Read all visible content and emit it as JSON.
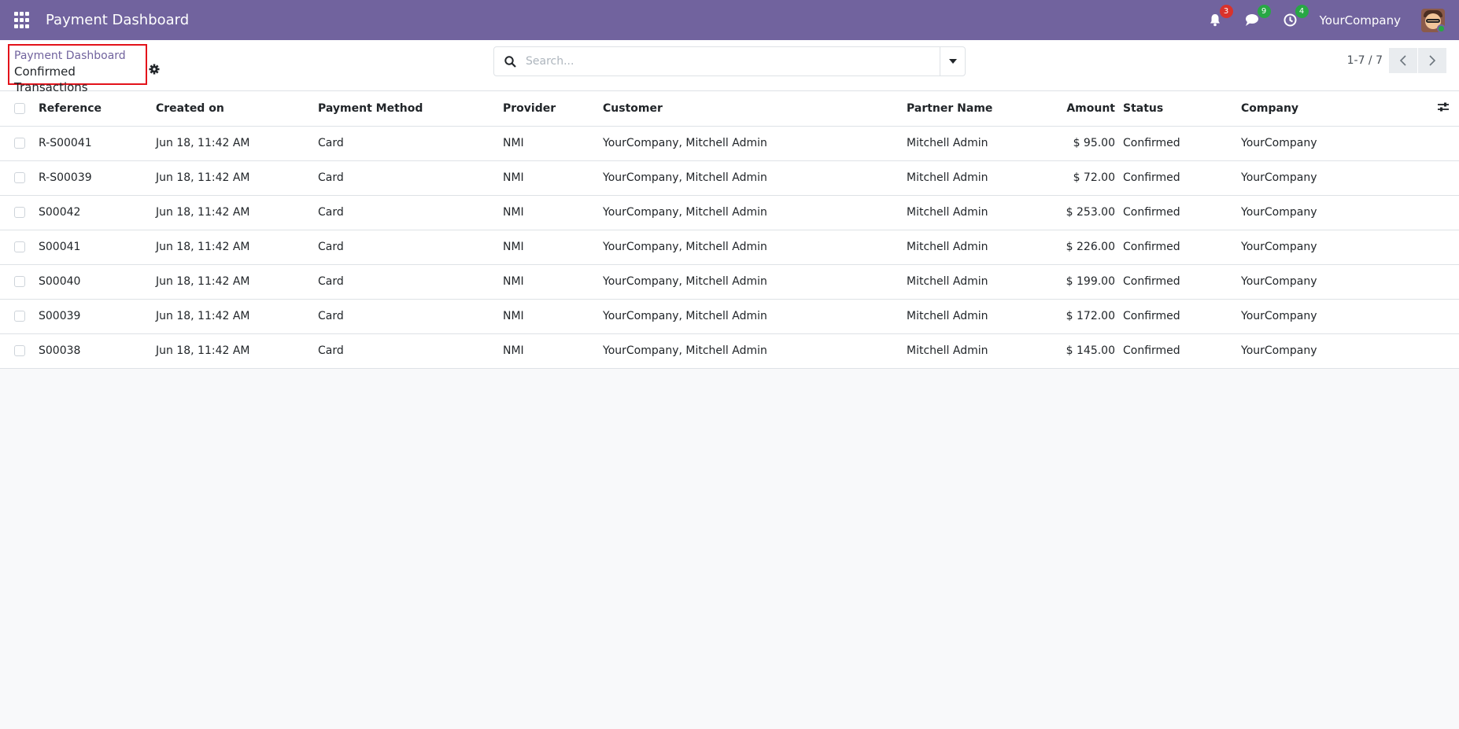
{
  "navbar": {
    "brand": "Payment Dashboard",
    "company": "YourCompany",
    "badges": {
      "activity": "3",
      "messages": "9",
      "clock": "4"
    },
    "colors": {
      "bg": "#71639e",
      "badge_red": "#e3342f",
      "badge_green": "#28a745"
    }
  },
  "breadcrumb": {
    "parent": "Payment Dashboard",
    "current": "Confirmed Transactions"
  },
  "search": {
    "placeholder": "Search..."
  },
  "pager": {
    "value": "1-7 / 7"
  },
  "table": {
    "columns": [
      "Reference",
      "Created on",
      "Payment Method",
      "Provider",
      "Customer",
      "Partner Name",
      "Amount",
      "Status",
      "Company"
    ],
    "rows": [
      {
        "ref": "R-S00041",
        "created": "Jun 18, 11:42 AM",
        "method": "Card",
        "provider": "NMI",
        "customer": "YourCompany, Mitchell Admin",
        "partner": "Mitchell Admin",
        "amount": "$ 95.00",
        "status": "Confirmed",
        "company": "YourCompany"
      },
      {
        "ref": "R-S00039",
        "created": "Jun 18, 11:42 AM",
        "method": "Card",
        "provider": "NMI",
        "customer": "YourCompany, Mitchell Admin",
        "partner": "Mitchell Admin",
        "amount": "$ 72.00",
        "status": "Confirmed",
        "company": "YourCompany"
      },
      {
        "ref": "S00042",
        "created": "Jun 18, 11:42 AM",
        "method": "Card",
        "provider": "NMI",
        "customer": "YourCompany, Mitchell Admin",
        "partner": "Mitchell Admin",
        "amount": "$ 253.00",
        "status": "Confirmed",
        "company": "YourCompany"
      },
      {
        "ref": "S00041",
        "created": "Jun 18, 11:42 AM",
        "method": "Card",
        "provider": "NMI",
        "customer": "YourCompany, Mitchell Admin",
        "partner": "Mitchell Admin",
        "amount": "$ 226.00",
        "status": "Confirmed",
        "company": "YourCompany"
      },
      {
        "ref": "S00040",
        "created": "Jun 18, 11:42 AM",
        "method": "Card",
        "provider": "NMI",
        "customer": "YourCompany, Mitchell Admin",
        "partner": "Mitchell Admin",
        "amount": "$ 199.00",
        "status": "Confirmed",
        "company": "YourCompany"
      },
      {
        "ref": "S00039",
        "created": "Jun 18, 11:42 AM",
        "method": "Card",
        "provider": "NMI",
        "customer": "YourCompany, Mitchell Admin",
        "partner": "Mitchell Admin",
        "amount": "$ 172.00",
        "status": "Confirmed",
        "company": "YourCompany"
      },
      {
        "ref": "S00038",
        "created": "Jun 18, 11:42 AM",
        "method": "Card",
        "provider": "NMI",
        "customer": "YourCompany, Mitchell Admin",
        "partner": "Mitchell Admin",
        "amount": "$ 145.00",
        "status": "Confirmed",
        "company": "YourCompany"
      }
    ]
  },
  "icons": {
    "apps": "apps-grid-icon",
    "activity": "bell-icon",
    "messages": "chat-icon",
    "clock": "clock-icon",
    "gear": "gear-icon",
    "search": "search-icon",
    "toggle": "caret-down-icon",
    "prev": "chevron-left-icon",
    "next": "chevron-right-icon",
    "optional_columns": "sliders-icon"
  }
}
